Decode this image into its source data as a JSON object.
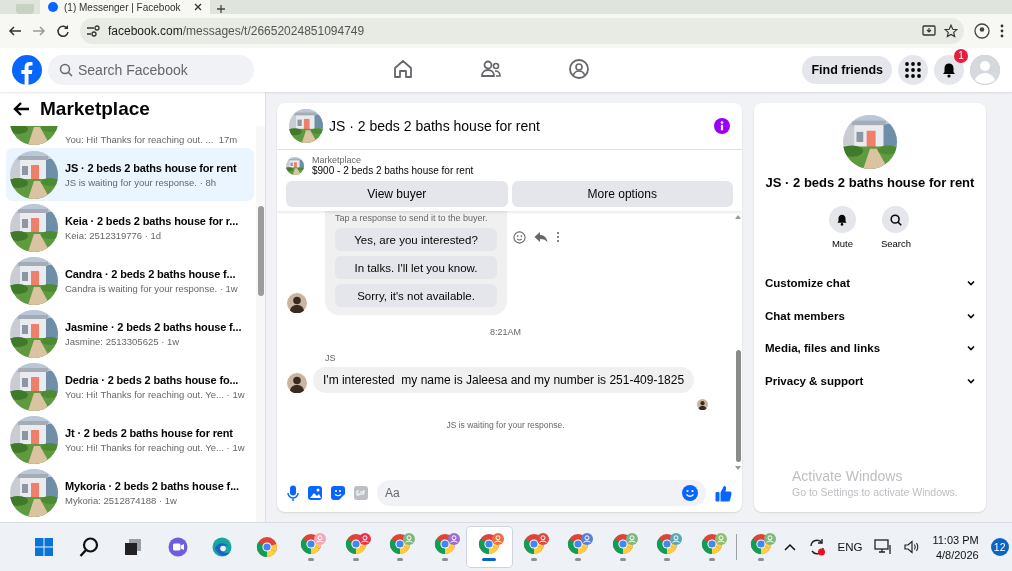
{
  "browser": {
    "tab_title": "(1) Messenger | Facebook",
    "url_host": "facebook.com",
    "url_path": "/messages/t/26652024851094749"
  },
  "header": {
    "search_placeholder": "Search Facebook",
    "nav": [
      {
        "kind": "home",
        "selected": false
      },
      {
        "kind": "friends",
        "selected": false
      },
      {
        "kind": "groups",
        "selected": false
      }
    ],
    "find_friends": "Find friends",
    "notification_count": "1"
  },
  "sidebar": {
    "title": "Marketplace",
    "conversations": [
      {
        "preview": "You: Hi! Thanks for reaching out. ...  17m",
        "selected": false
      },
      {
        "title": "JS · 2 beds 2 baths house for rent",
        "preview": "JS is waiting for your response. · 8h",
        "selected": true
      },
      {
        "title": "Keia · 2 beds 2 baths house for r...",
        "preview": "Keia: 2512319776 · 1d",
        "selected": false
      },
      {
        "title": "Candra · 2 beds 2 baths house f...",
        "preview": "Candra is waiting for your response. · 1w",
        "selected": false
      },
      {
        "title": "Jasmine · 2 beds 2 baths house f...",
        "preview": "Jasmine: 2513305625 · 1w",
        "selected": false
      },
      {
        "title": "Dedria · 2 beds 2 baths house fo...",
        "preview": "You: Hi! Thanks for reaching out. Ye... · 1w",
        "selected": false
      },
      {
        "title": "Jt · 2 beds 2 baths house for rent",
        "preview": "You: Hi! Thanks for reaching out. Ye... · 1w",
        "selected": false
      },
      {
        "title": "Mykoria · 2 beds 2 baths house f...",
        "preview": "Mykoria: 2512874188 · 1w",
        "selected": false
      }
    ]
  },
  "chat": {
    "title": "JS · 2 beds 2 baths house for rent",
    "listing": {
      "source": "Marketplace",
      "item": "$900 - 2 beds 2 baths house for rent"
    },
    "buttons": [
      "View buyer",
      "More options"
    ],
    "quick_reply_hint": "Tap a response to send it to the buyer.",
    "quick_replies": [
      "Yes, are you interested?",
      "In talks. I'll let you know.",
      "Sorry, it's not available."
    ],
    "time_divider": "8:21AM",
    "message": {
      "sender": "JS",
      "text": "I'm interested  my name is Jaleesa and my number is 251-409-1825"
    },
    "status": "JS is waiting for your response.",
    "composer_placeholder": "Aa"
  },
  "details": {
    "title": "JS · 2 beds 2 baths house for rent",
    "actions": [
      {
        "kind": "mute",
        "label": "Mute"
      },
      {
        "kind": "search",
        "label": "Search"
      }
    ],
    "sections": [
      {
        "label": "Customize chat",
        "expanded": false
      },
      {
        "label": "Chat members",
        "expanded": false
      },
      {
        "label": "Media, files and links",
        "expanded": false
      },
      {
        "label": "Privacy & support",
        "expanded": false
      }
    ]
  },
  "os_notice": {
    "title": "Activate Windows",
    "subtitle": "Go to Settings to activate Windows."
  },
  "taskbar": {
    "apps": [
      {
        "kind": "start",
        "selected": false
      },
      {
        "kind": "search",
        "selected": false
      },
      {
        "kind": "task-view",
        "selected": false
      },
      {
        "kind": "teams",
        "selected": false
      },
      {
        "kind": "edge",
        "selected": false
      },
      {
        "kind": "chrome",
        "selected": false
      },
      {
        "kind": "chrome-profile",
        "color": "#f4a6b8",
        "selected": false
      },
      {
        "kind": "chrome-profile",
        "color": "#e8344a",
        "selected": false
      },
      {
        "kind": "chrome-profile",
        "color": "#7fb77e",
        "selected": false
      },
      {
        "kind": "chrome-profile",
        "color": "#9a6fd0",
        "selected": false
      },
      {
        "kind": "chrome-profile",
        "color": "#f26b3a",
        "selected": true
      },
      {
        "kind": "chrome-profile",
        "color": "#e0483c",
        "selected": false
      },
      {
        "kind": "chrome-profile",
        "color": "#5b7fd6",
        "selected": false
      },
      {
        "kind": "chrome-profile",
        "color": "#7fb77e",
        "selected": false
      },
      {
        "kind": "chrome-profile",
        "color": "#5aa7b5",
        "selected": false
      },
      {
        "kind": "chrome-profile",
        "color": "#8fbf6f",
        "selected": false
      },
      {
        "kind": "separator"
      },
      {
        "kind": "chrome-profile",
        "color": "#7fb77e",
        "selected": false
      }
    ],
    "language": "ENG",
    "time": "11:03 PM",
    "date": "4/8/2026",
    "notification_count": "12"
  }
}
